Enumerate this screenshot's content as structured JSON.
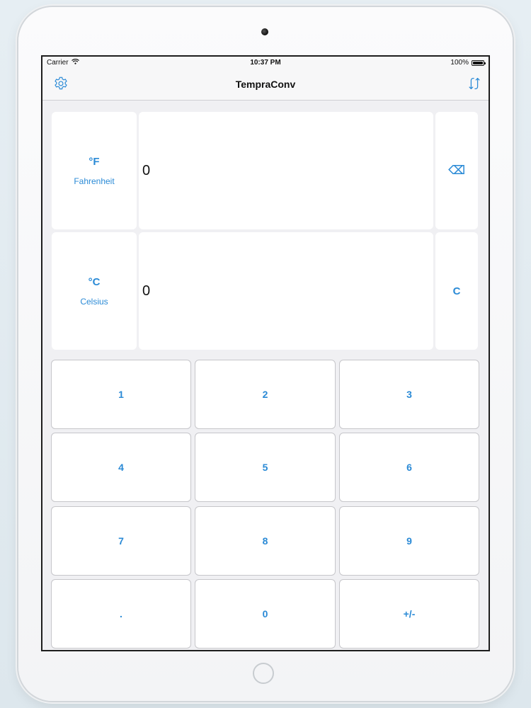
{
  "status_bar": {
    "carrier": "Carrier",
    "time": "10:37 PM",
    "battery_percent": "100%"
  },
  "nav": {
    "title": "TempraConv",
    "left_icon": "gear-icon",
    "right_icon": "swap-arrows-icon"
  },
  "converter": {
    "fahrenheit": {
      "symbol": "°F",
      "name": "Fahrenheit",
      "value": "0",
      "action_label": "⌫"
    },
    "celsius": {
      "symbol": "°C",
      "name": "Celsius",
      "value": "0",
      "action_label": "C"
    }
  },
  "keypad": {
    "k1": "1",
    "k2": "2",
    "k3": "3",
    "k4": "4",
    "k5": "5",
    "k6": "6",
    "k7": "7",
    "k8": "8",
    "k9": "9",
    "dot": ".",
    "k0": "0",
    "sign": "+/-"
  },
  "colors": {
    "accent": "#2a8ad6",
    "background": "#f0f0f3",
    "tile": "#ffffff"
  }
}
